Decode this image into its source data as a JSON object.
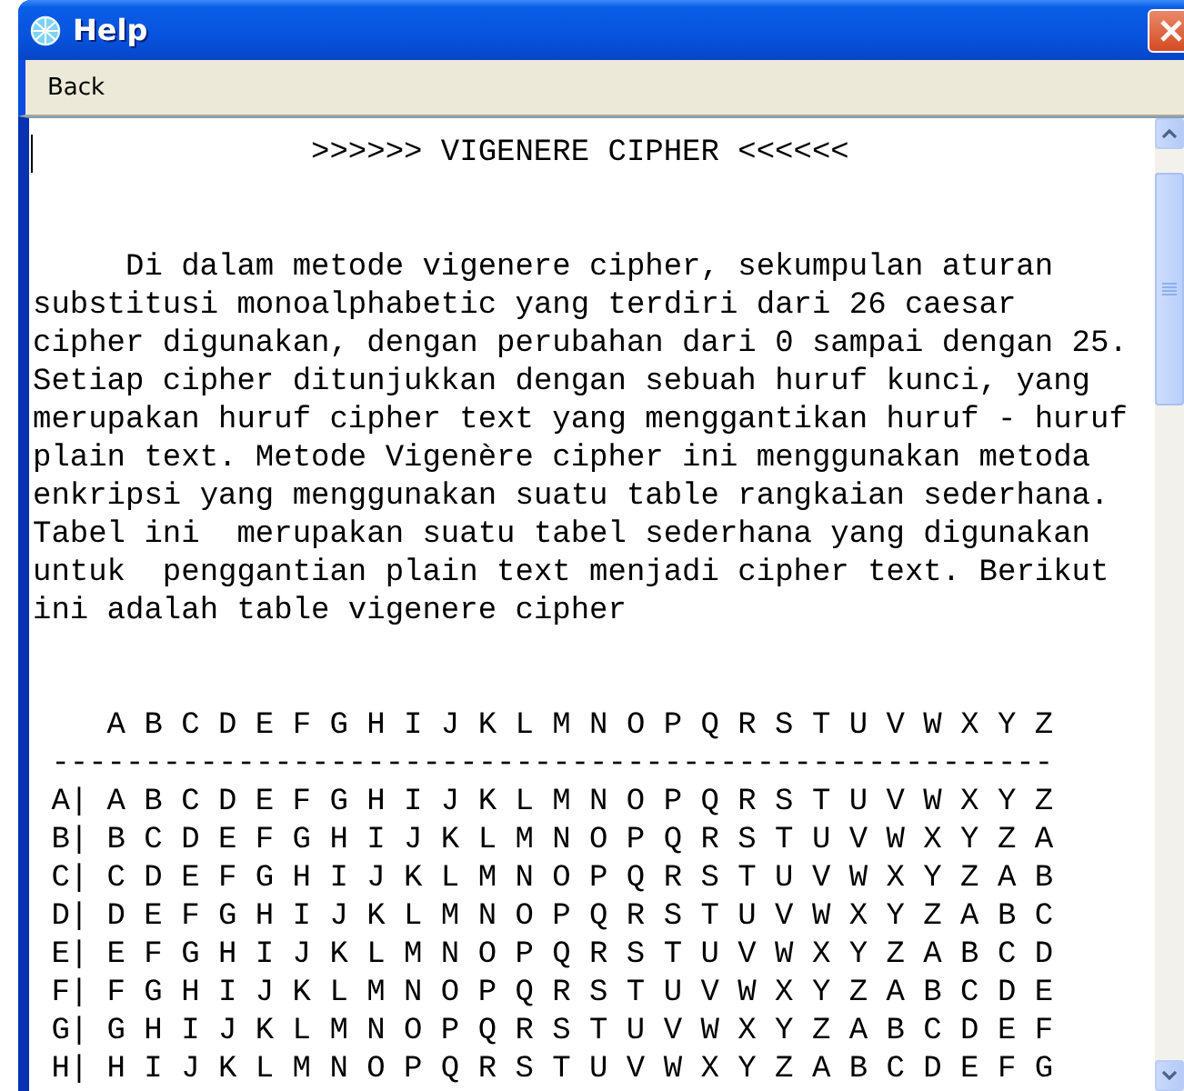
{
  "window": {
    "title": "Help"
  },
  "menu": [
    {
      "label": "Back"
    }
  ],
  "document": {
    "heading": ">>>>>> VIGENERE CIPHER <<<<<<",
    "paragraph": "Di dalam metode vigenere cipher, sekumpulan aturan\nsubstitusi monoalphabetic yang terdiri dari 26 caesar\ncipher digunakan, dengan perubahan dari 0 sampai dengan 25.\nSetiap cipher ditunjukkan dengan sebuah huruf kunci, yang\nmerupakan huruf cipher text yang menggantikan huruf - huruf\nplain text. Metode Vigenère cipher ini menggunakan metoda\nenkripsi yang menggunakan suatu table rangkaian sederhana.\nTabel ini  merupakan suatu tabel sederhana yang digunakan\nuntuk  penggantian plain text menjadi cipher text. Berikut\nini adalah table vigenere cipher",
    "table": {
      "header": "A B C D E F G H I J K L M N O P Q R S T U V W X Y Z",
      "separator": "------------------------------------------------------",
      "rows": [
        {
          "label": "A|",
          "letters": "A B C D E F G H I J K L M N O P Q R S T U V W X Y Z"
        },
        {
          "label": "B|",
          "letters": "B C D E F G H I J K L M N O P Q R S T U V W X Y Z A"
        },
        {
          "label": "C|",
          "letters": "C D E F G H I J K L M N O P Q R S T U V W X Y Z A B"
        },
        {
          "label": "D|",
          "letters": "D E F G H I J K L M N O P Q R S T U V W X Y Z A B C"
        },
        {
          "label": "E|",
          "letters": "E F G H I J K L M N O P Q R S T U V W X Y Z A B C D"
        },
        {
          "label": "F|",
          "letters": "F G H I J K L M N O P Q R S T U V W X Y Z A B C D E"
        },
        {
          "label": "G|",
          "letters": "G H I J K L M N O P Q R S T U V W X Y Z A B C D E F"
        },
        {
          "label": "H|",
          "letters": "H I J K L M N O P Q R S T U V W X Y Z A B C D E F G"
        }
      ]
    }
  }
}
